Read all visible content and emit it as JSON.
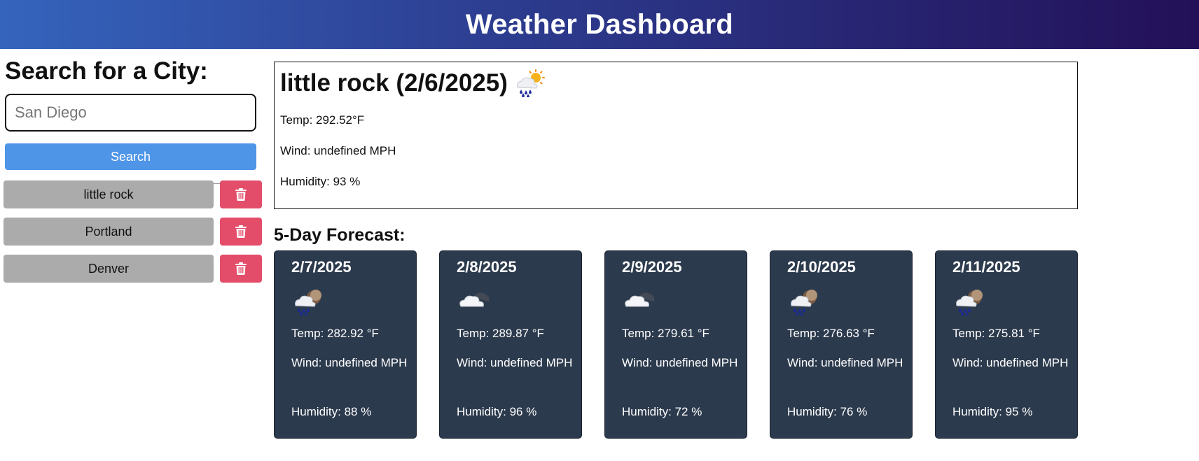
{
  "header": {
    "title": "Weather Dashboard"
  },
  "search": {
    "heading": "Search for a City:",
    "placeholder": "San Diego",
    "value": "",
    "button_label": "Search"
  },
  "history": [
    {
      "label": "little rock",
      "delete_icon": "trash-icon"
    },
    {
      "label": "Portland",
      "delete_icon": "trash-icon"
    },
    {
      "label": "Denver",
      "delete_icon": "trash-icon"
    }
  ],
  "current": {
    "title": "little rock (2/6/2025)",
    "icon": "rain-sun-icon",
    "temp": "Temp: 292.52°F",
    "wind": "Wind: undefined MPH",
    "humidity": "Humidity: 93 %"
  },
  "forecast": {
    "heading": "5-Day Forecast:",
    "days": [
      {
        "date": "2/7/2025",
        "icon": "rain-night-icon",
        "temp": "Temp: 282.92 °F",
        "wind": "Wind: undefined MPH",
        "humidity": "Humidity: 88 %"
      },
      {
        "date": "2/8/2025",
        "icon": "cloud-night-icon",
        "temp": "Temp: 289.87 °F",
        "wind": "Wind: undefined MPH",
        "humidity": "Humidity: 96 %"
      },
      {
        "date": "2/9/2025",
        "icon": "cloud-night-icon",
        "temp": "Temp: 279.61 °F",
        "wind": "Wind: undefined MPH",
        "humidity": "Humidity: 72 %"
      },
      {
        "date": "2/10/2025",
        "icon": "rain-night-icon",
        "temp": "Temp: 276.63 °F",
        "wind": "Wind: undefined MPH",
        "humidity": "Humidity: 76 %"
      },
      {
        "date": "2/11/2025",
        "icon": "rain-night-icon",
        "temp": "Temp: 275.81 °F",
        "wind": "Wind: undefined MPH",
        "humidity": "Humidity: 95 %"
      }
    ]
  },
  "colors": {
    "header_start": "#3564bd",
    "header_end": "#231058",
    "search_button": "#4e95e8",
    "history_button": "#ababab",
    "delete_button": "#e34d6a",
    "forecast_card": "#2c3a4d"
  }
}
